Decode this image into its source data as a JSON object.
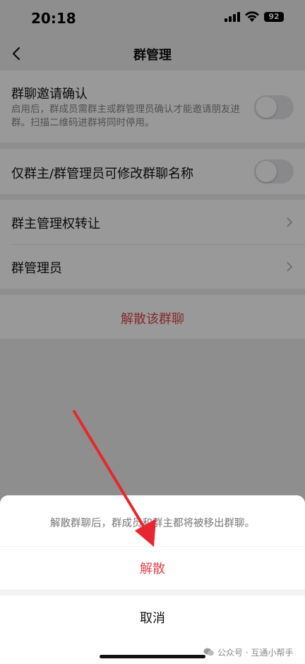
{
  "status_bar": {
    "time": "20:18",
    "battery": "92"
  },
  "nav": {
    "title": "群管理"
  },
  "settings": {
    "invite_confirm": {
      "title": "群聊邀请确认",
      "desc": "启用后，群成员需群主或群管理员确认才能邀请朋友进群。扫描二维码进群将同时停用。"
    },
    "rename_only_admin": {
      "title": "仅群主/群管理员可修改群聊名称"
    },
    "transfer_owner": {
      "title": "群主管理权转让"
    },
    "admins": {
      "title": "群管理员"
    },
    "dissolve": {
      "label": "解散该群聊"
    }
  },
  "sheet": {
    "message": "解散群聊后，群成员和群主都将被移出群聊。",
    "confirm_label": "解散",
    "cancel_label": "取消"
  },
  "watermark": {
    "text": "公众号 · 互通小帮手"
  },
  "colors": {
    "danger": "#e0464c",
    "arrow": "#e8262f"
  },
  "icons": [
    "back-icon",
    "chevron-right-icon",
    "signal-icon",
    "wifi-icon",
    "battery-icon",
    "wechat-icon"
  ]
}
